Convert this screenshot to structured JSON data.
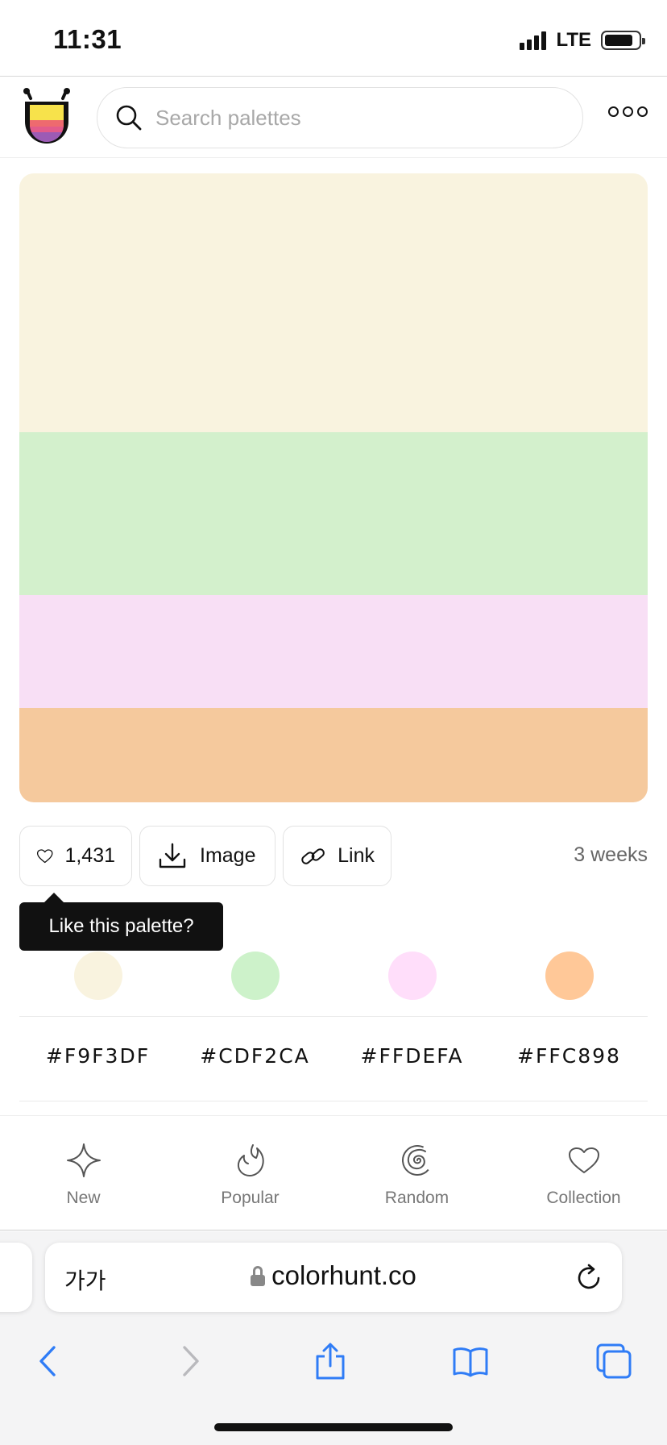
{
  "status_bar": {
    "time": "11:31",
    "network": "LTE"
  },
  "header": {
    "search_placeholder": "Search palettes",
    "logo_icon": "tongue-face-logo",
    "more_icon": "more-options-icon"
  },
  "palette": {
    "colors": [
      "#F9F3DF",
      "#CDF2CA",
      "#FFDEFA",
      "#FFC898"
    ],
    "likes": "1,431",
    "image_label": "Image",
    "link_label": "Link",
    "age": "3 weeks",
    "tooltip": "Like this palette?"
  },
  "codes": [
    "#F9F3DF",
    "#CDF2CA",
    "#FFDEFA",
    "#FFC898"
  ],
  "bottom_nav": {
    "items": [
      {
        "label": "New",
        "icon": "sparkle-icon"
      },
      {
        "label": "Popular",
        "icon": "flame-icon"
      },
      {
        "label": "Random",
        "icon": "spiral-icon"
      },
      {
        "label": "Collection",
        "icon": "heart-icon"
      }
    ]
  },
  "browser": {
    "text_size_label": "가가",
    "url": "colorhunt.co"
  }
}
